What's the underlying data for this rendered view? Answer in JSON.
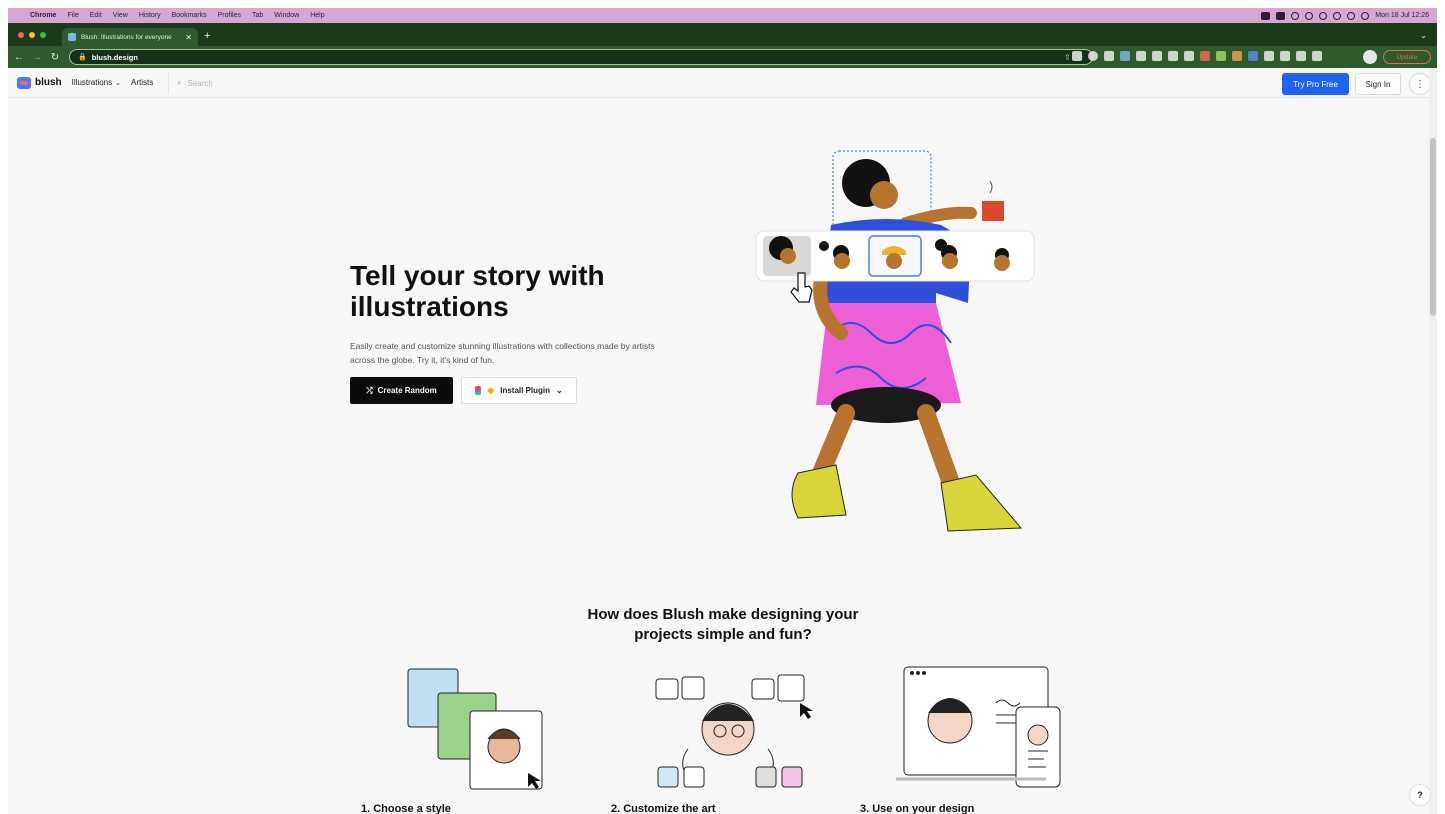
{
  "menubar": {
    "app": "Chrome",
    "items": [
      "File",
      "Edit",
      "View",
      "History",
      "Bookmarks",
      "Profiles",
      "Tab",
      "Window",
      "Help"
    ],
    "clock": "Mon 18 Jul  12:26"
  },
  "browser": {
    "tab_title": "Blush: Illustrations for everyone",
    "url": "blush.design",
    "update_label": "Update"
  },
  "site": {
    "logo": "blush",
    "nav": {
      "illustrations": "Illustrations",
      "artists": "Artists"
    },
    "search_placeholder": "Search",
    "try_pro": "Try Pro Free",
    "sign_in": "Sign In",
    "more": "⋮"
  },
  "hero": {
    "title": "Tell your story with illustrations",
    "subtitle": "Easily create and customize stunning illustrations with collections made by artists across the globe. Try it, it's kind of fun.",
    "create_random": "Create Random",
    "install_plugin": "Install Plugin"
  },
  "how": {
    "title": "How does Blush make designing your projects simple and fun?",
    "steps": [
      "1. Choose a style",
      "2. Customize the art",
      "3. Use on your design"
    ]
  },
  "help": "?",
  "colors": {
    "accent": "#1f64f0",
    "menubar": "#d7a7d3",
    "browser": "#2f5a2b",
    "dress": "#ec5fd6",
    "shirt": "#2f4fd8",
    "shoes": "#d8d53a"
  }
}
